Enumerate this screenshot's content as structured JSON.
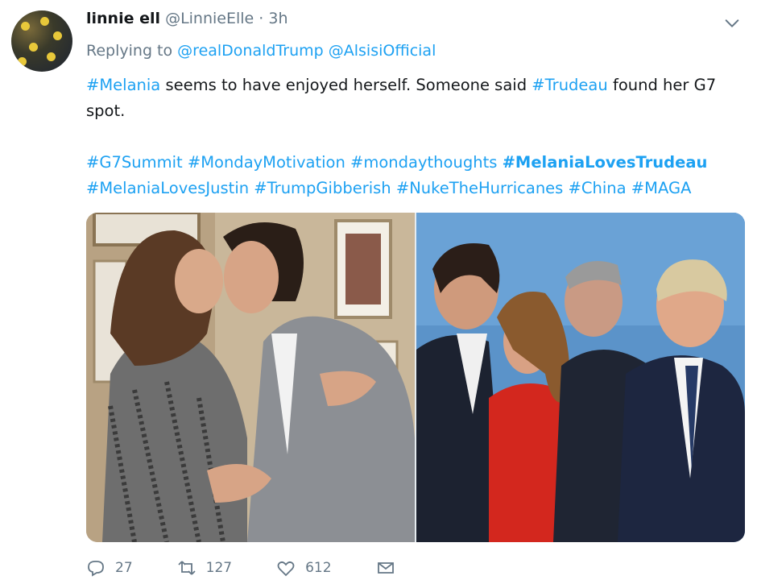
{
  "tweet": {
    "display_name": "linnie ell",
    "handle": "@LinnieElle",
    "separator": "·",
    "time": "3h",
    "replying_label": "Replying to",
    "replying_to": [
      "@realDonaldTrump",
      "@AlsisiOfficial"
    ],
    "text": {
      "hashtag_1": "#Melania",
      "part_1": " seems to have enjoyed herself. Someone said ",
      "hashtag_2": "#Trudeau",
      "part_2": " found her G7 spot."
    },
    "hashtags_line1": [
      "#G7Summit",
      "#MondayMotivation",
      "#mondaythoughts",
      "#MelaniaLovesTrudeau"
    ],
    "hashtags_line2": [
      "#MelaniaLovesJustin",
      "#TrumpGibberish",
      "#NukeTheHurricanes",
      "#China",
      "#MAGA"
    ],
    "counts": {
      "replies": "27",
      "retweets": "127",
      "likes": "612"
    }
  },
  "icons": {
    "more": "chevron-down-icon",
    "reply": "reply-icon",
    "retweet": "retweet-icon",
    "like": "heart-icon",
    "dm": "message-icon"
  },
  "colors": {
    "link": "#1da1f2",
    "muted": "#657786",
    "text": "#14171a"
  }
}
